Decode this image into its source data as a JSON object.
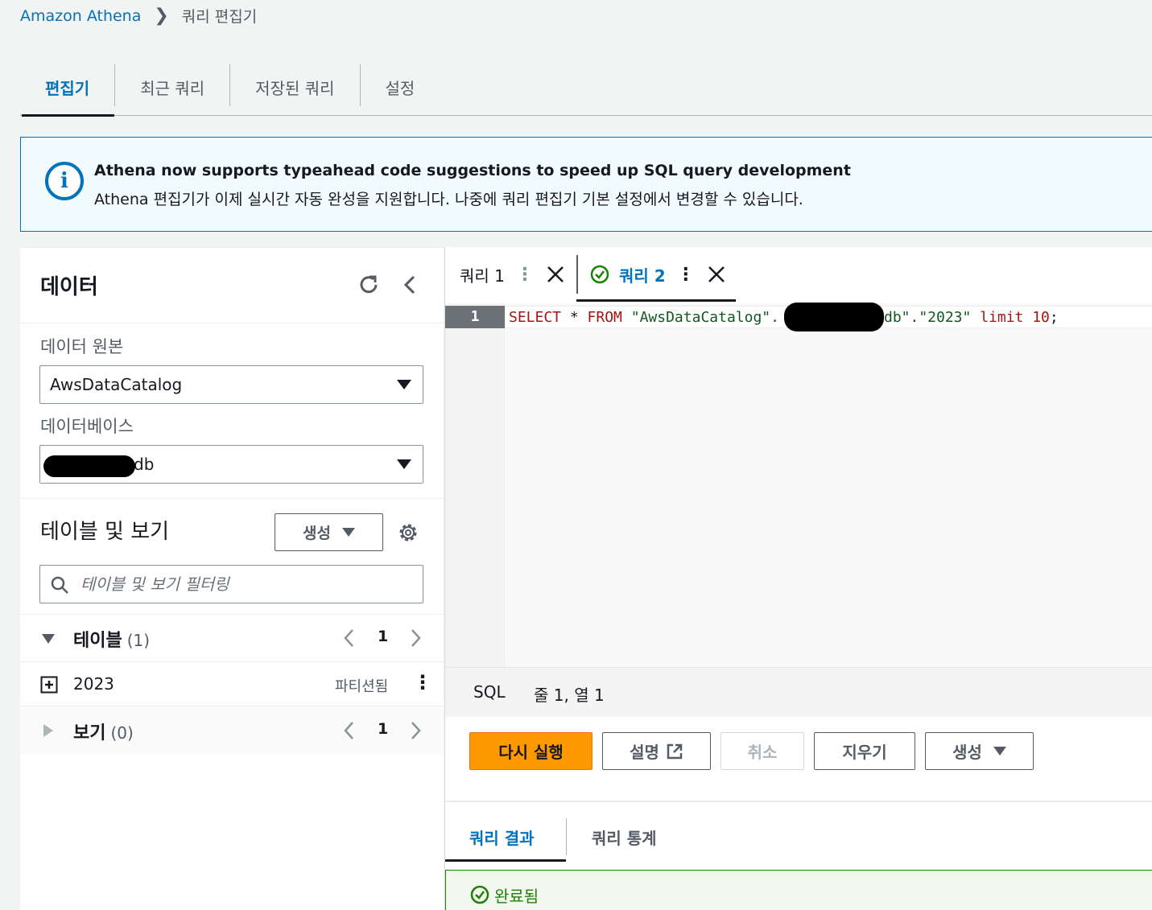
{
  "breadcrumb": {
    "root": "Amazon Athena",
    "current": "쿼리 편집기"
  },
  "top_tabs": [
    "편집기",
    "최근 쿼리",
    "저장된 쿼리",
    "설정"
  ],
  "banner": {
    "title": "Athena now supports typeahead code suggestions to speed up SQL query development",
    "body": "Athena 편집기가 이제 실시간 자동 완성을 지원합니다. 나중에 쿼리 편집기 기본 설정에서 변경할 수 있습니다."
  },
  "data_panel": {
    "title": "데이터",
    "source_label": "데이터 원본",
    "source_value": "AwsDataCatalog",
    "database_label": "데이터베이스",
    "database_value_suffix": "db",
    "tables_views_title": "테이블 및 보기",
    "create_label": "생성",
    "filter_placeholder": "테이블 및 보기 필터링",
    "tables": {
      "label": "테이블",
      "count": "(1)",
      "page": "1"
    },
    "table_rows": [
      {
        "name": "2023",
        "badge": "파티션됨"
      }
    ],
    "views": {
      "label": "보기",
      "count": "(0)",
      "page": "1"
    }
  },
  "editor": {
    "tabs": [
      {
        "label": "쿼리 1"
      },
      {
        "label": "쿼리 2",
        "status": "success"
      }
    ],
    "line_number": "1",
    "code": {
      "select": "SELECT",
      "star": " * ",
      "from": "FROM",
      "catalog": " \"AwsDataCatalog\".",
      "db_tail": "db\".\"2023\"",
      "limit": " limit ",
      "num": "10",
      "end": ";"
    },
    "status": {
      "lang": "SQL",
      "position": "줄 1, 열 1"
    }
  },
  "actions": {
    "rerun": "다시 실행",
    "explain": "설명",
    "cancel": "취소",
    "clear": "지우기",
    "create": "생성"
  },
  "results": {
    "tabs": [
      "쿼리 결과",
      "쿼리 통계"
    ],
    "status": "완료됨"
  },
  "colors": {
    "link": "#0073bb",
    "primary": "#ff9900",
    "success": "#1d8102"
  }
}
